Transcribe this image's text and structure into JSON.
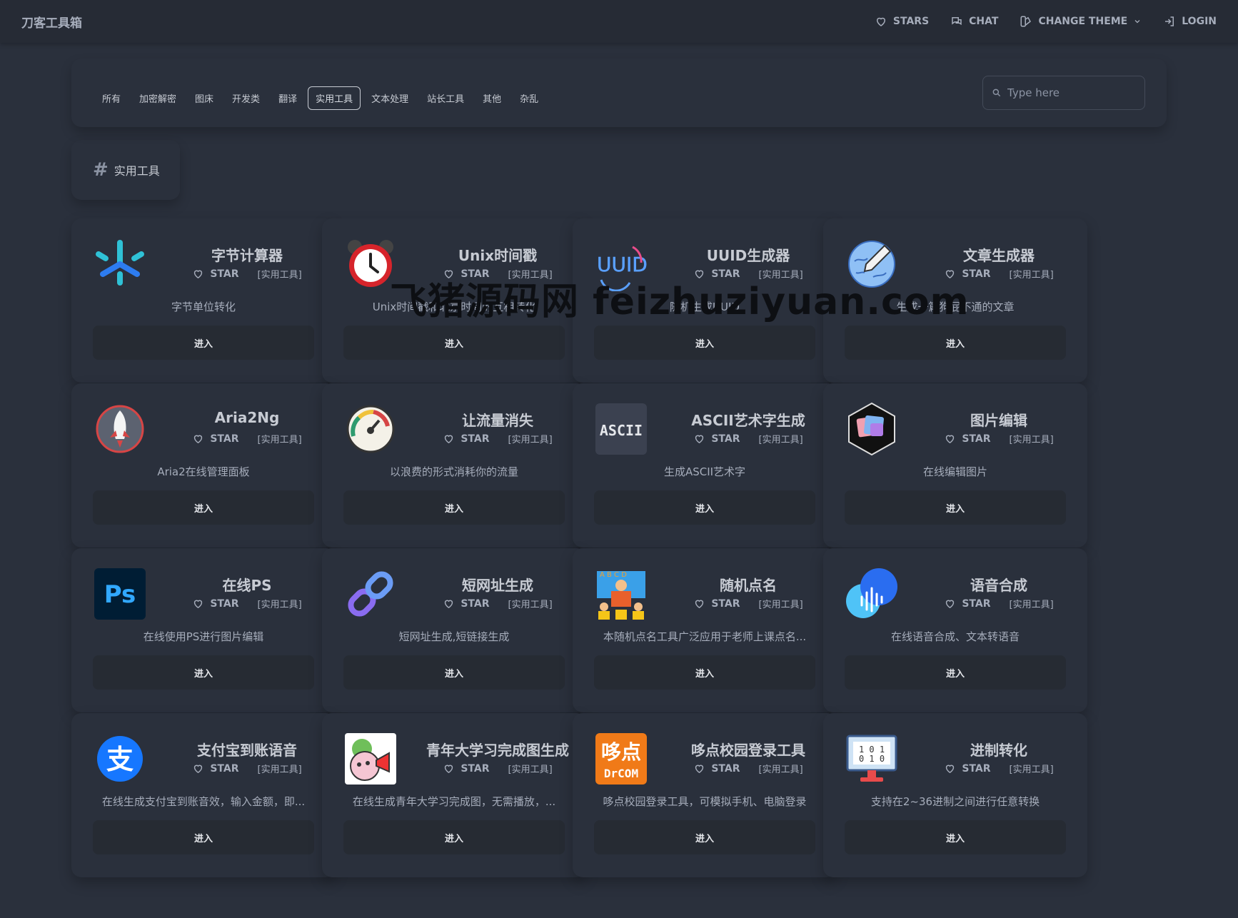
{
  "brand": "刀客工具箱",
  "nav": {
    "stars": "STARS",
    "chat": "CHAT",
    "change_theme": "CHANGE THEME",
    "login": "LOGIN"
  },
  "tabs": [
    {
      "label": "所有",
      "active": false
    },
    {
      "label": "加密解密",
      "active": false
    },
    {
      "label": "图床",
      "active": false
    },
    {
      "label": "开发类",
      "active": false
    },
    {
      "label": "翻译",
      "active": false
    },
    {
      "label": "实用工具",
      "active": true
    },
    {
      "label": "文本处理",
      "active": false
    },
    {
      "label": "站长工具",
      "active": false
    },
    {
      "label": "其他",
      "active": false
    },
    {
      "label": "杂乱",
      "active": false
    }
  ],
  "search": {
    "placeholder": "Type here",
    "value": ""
  },
  "section": {
    "hash": "#",
    "title": "实用工具"
  },
  "card_common": {
    "star_label": "STAR",
    "tag": "[实用工具]",
    "enter_label": "进入"
  },
  "cards": [
    {
      "title": "字节计算器",
      "desc": "字节单位转化",
      "icon": "snowflake-icon"
    },
    {
      "title": "Unix时间戳",
      "desc": "Unix时间戳和北京时间的互相转化",
      "icon": "alarm-clock-icon"
    },
    {
      "title": "UUID生成器",
      "desc": "随机生成UUID",
      "icon": "uuid-icon"
    },
    {
      "title": "文章生成器",
      "desc": "生成一篇狗屁不通的文章",
      "icon": "pencil-globe-icon"
    },
    {
      "title": "Aria2Ng",
      "desc": "Aria2在线管理面板",
      "icon": "rocket-icon"
    },
    {
      "title": "让流量消失",
      "desc": "以浪费的形式消耗你的流量",
      "icon": "speedometer-icon"
    },
    {
      "title": "ASCII艺术字生成",
      "desc": "生成ASCII艺术字",
      "icon": "ascii-icon"
    },
    {
      "title": "图片编辑",
      "desc": "在线编辑图片",
      "icon": "image-layers-icon"
    },
    {
      "title": "在线PS",
      "desc": "在线使用PS进行图片编辑",
      "icon": "photoshop-icon"
    },
    {
      "title": "短网址生成",
      "desc": "短网址生成,短链接生成",
      "icon": "link-icon"
    },
    {
      "title": "随机点名",
      "desc": "本随机点名工具广泛应用于老师上课点名...",
      "icon": "classroom-icon"
    },
    {
      "title": "语音合成",
      "desc": "在线语音合成、文本转语音",
      "icon": "voice-wave-icon"
    },
    {
      "title": "支付宝到账语音",
      "desc": "在线生成支付宝到账音效，输入金额，即...",
      "icon": "alipay-icon"
    },
    {
      "title": "青年大学习完成图生成",
      "desc": "在线生成青年大学习完成图，无需播放，...",
      "icon": "cartoon-megaphone-icon"
    },
    {
      "title": "哆点校园登录工具",
      "desc": "哆点校园登录工具，可模拟手机、电脑登录",
      "icon": "duodian-icon"
    },
    {
      "title": "进制转化",
      "desc": "支持在2~36进制之间进行任意转换",
      "icon": "binary-monitor-icon"
    }
  ],
  "watermark": "飞猪源码网 feizhuziyuan.com",
  "colors": {
    "background": "#2a303c",
    "topbar": "#262b35",
    "text": "#a6adbb",
    "button": "#262b33"
  }
}
